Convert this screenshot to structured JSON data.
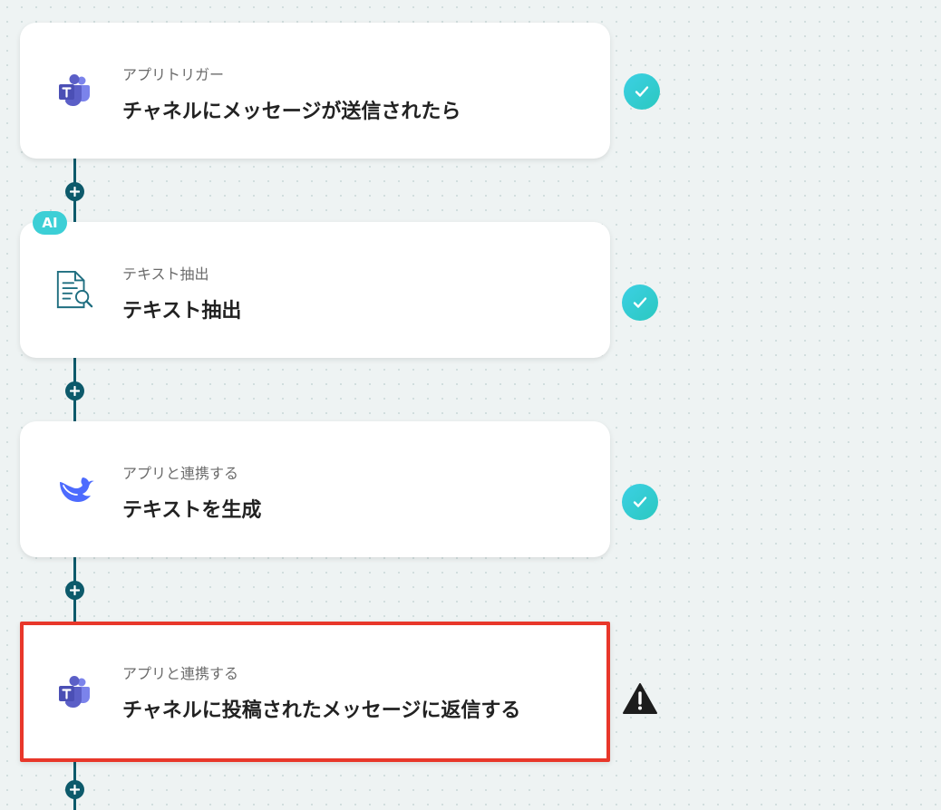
{
  "flow": {
    "steps": [
      {
        "sub": "アプリトリガー",
        "title": "チャネルにメッセージが送信されたら",
        "icon": "teams-icon",
        "status": "done"
      },
      {
        "sub": "テキスト抽出",
        "title": "テキスト抽出",
        "icon": "document-search-icon",
        "badge": "AI",
        "status": "done"
      },
      {
        "sub": "アプリと連携する",
        "title": "テキストを生成",
        "icon": "deepseek-whale-icon",
        "status": "done"
      },
      {
        "sub": "アプリと連携する",
        "title": "チャネルに投稿されたメッセージに返信する",
        "icon": "teams-icon",
        "status": "warning",
        "selected": true
      }
    ]
  },
  "colors": {
    "connector": "#0d5a6b",
    "check": "#2bc8d2",
    "highlight": "#e8372a",
    "ai_badge": "#3ccfd6",
    "teams": "#5b5fc7"
  }
}
